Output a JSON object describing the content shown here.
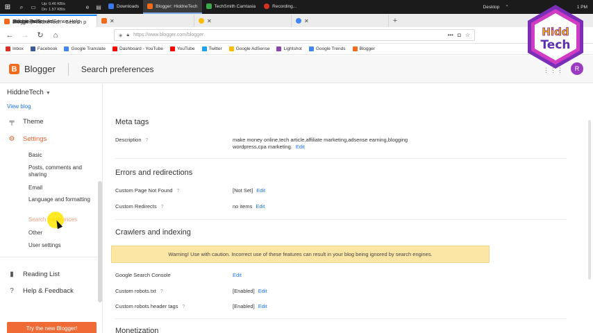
{
  "taskbar": {
    "net_up": "Up: 0.46 KB/s",
    "net_down": "Dn: 1.57 KB/s",
    "apps": [
      {
        "label": "Downloads",
        "color": "#3b78e7"
      },
      {
        "label": "Blogger: HiddneTech",
        "color": "#f26b1d"
      },
      {
        "label": "TechSmith Camtasia",
        "color": "#3aa84a"
      },
      {
        "label": "Recording...",
        "color": "#d93025"
      }
    ],
    "desktop_label": "Desktop",
    "clock": "1 PM"
  },
  "browser": {
    "tabs": [
      {
        "label": "Blogger: HiddneTech - Search p",
        "color": "#f26b1d"
      },
      {
        "label": "HiddneTech",
        "color": "#f26b1d"
      },
      {
        "label": "Google AdSense",
        "color": "#fbbc05"
      },
      {
        "label": "Ads.txt guide - AdSense Help",
        "color": "#4285f4"
      }
    ],
    "url": "https://www.blogger.com/blogger"
  },
  "bookmarks": [
    {
      "label": "Inbox",
      "color": "#d93025"
    },
    {
      "label": "Facebook",
      "color": "#3b5998"
    },
    {
      "label": "Google Translate",
      "color": "#4285f4"
    },
    {
      "label": "Dashboard - YouTube",
      "color": "#ff0000"
    },
    {
      "label": "YouTube",
      "color": "#ff0000"
    },
    {
      "label": "Twitter",
      "color": "#1da1f2"
    },
    {
      "label": "Google AdSense",
      "color": "#fbbc05"
    },
    {
      "label": "Lightshot",
      "color": "#8e44ad"
    },
    {
      "label": "Google Trends",
      "color": "#4285f4"
    },
    {
      "label": "Blogger",
      "color": "#f26b1d"
    }
  ],
  "header": {
    "brand": "Blogger",
    "page_title": "Search preferences",
    "avatar_initial": "R"
  },
  "watermark": {
    "line1": "Hidd",
    "line2": "Tech"
  },
  "sidebar": {
    "blog_name": "HiddneTech",
    "view_blog": "View blog",
    "theme": "Theme",
    "settings": "Settings",
    "sub_items": [
      "Basic",
      "Posts, comments and sharing",
      "Email",
      "Language and formatting",
      "Search preferences",
      "Other",
      "User settings"
    ],
    "reading_list": "Reading List",
    "help": "Help & Feedback",
    "try_new": "Try the new Blogger!"
  },
  "main": {
    "meta_tags": {
      "heading": "Meta tags",
      "description_label": "Description",
      "description_value": "make money online,tech article,affiliate marketing,adsense earning,blogging wordpress,cpa marketing."
    },
    "errors": {
      "heading": "Errors and redirections",
      "not_found_label": "Custom Page Not Found",
      "not_found_value": "[Not Set]",
      "redirects_label": "Custom Redirects",
      "redirects_value": "no items"
    },
    "crawlers": {
      "heading": "Crawlers and indexing",
      "warning": "Warning! Use with caution. Incorrect use of these features can result in your blog being ignored by search engines.",
      "console_label": "Google Search Console",
      "robots_label": "Custom robots.txt",
      "robots_value": "[Enabled]",
      "robots_header_label": "Custom robots header tags",
      "robots_header_value": "[Enabled]"
    },
    "monetization_heading": "Monetization",
    "edit_label": "Edit"
  }
}
